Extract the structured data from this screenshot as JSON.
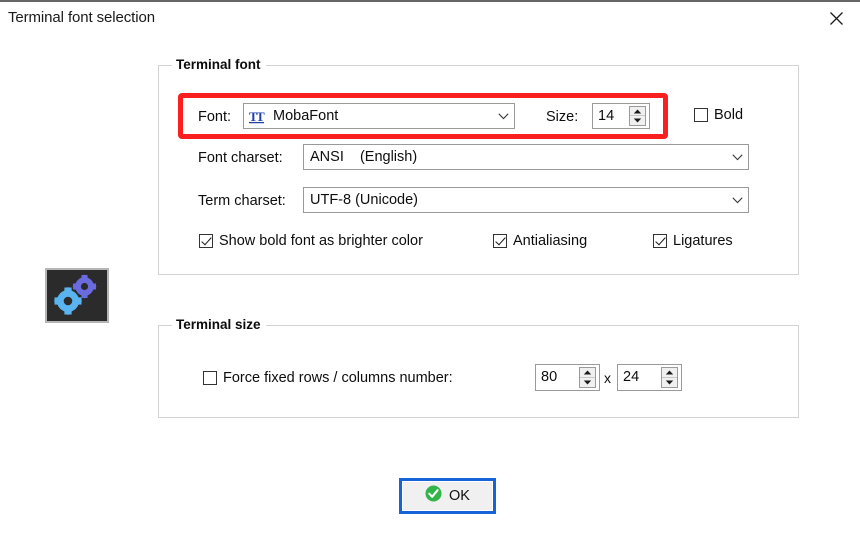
{
  "window": {
    "title": "Terminal font selection",
    "close_icon": "close-icon"
  },
  "sidebar": {
    "preview_icon": "gears-icon"
  },
  "groups": {
    "terminal_font": {
      "legend": "Terminal font",
      "font_label": "Font:",
      "font_value": "MobaFont",
      "font_icon": "truetype-font-icon",
      "size_label": "Size:",
      "size_value": "14",
      "bold_label": "Bold",
      "bold_checked": false,
      "font_charset_label": "Font charset:",
      "font_charset_value": "ANSI    (English)",
      "term_charset_label": "Term charset:",
      "term_charset_value": "UTF-8 (Unicode)",
      "show_bold_label": "Show bold font as brighter color",
      "show_bold_checked": true,
      "antialiasing_label": "Antialiasing",
      "antialiasing_checked": true,
      "ligatures_label": "Ligatures",
      "ligatures_checked": true
    },
    "terminal_size": {
      "legend": "Terminal size",
      "force_fixed_label": "Force fixed rows / columns number:",
      "force_fixed_checked": false,
      "columns_value": "80",
      "separator": "x",
      "rows_value": "24"
    }
  },
  "footer": {
    "ok_label": "OK",
    "ok_icon": "green-check-circle-icon"
  },
  "annotation": {
    "highlight_color": "#fa2020",
    "target": "font-and-size-row"
  },
  "colors": {
    "accent_blue": "#1565d8",
    "highlight_red": "#fa2020",
    "ok_green": "#31b54a",
    "groupbox_border": "#d3d3d3",
    "text": "#0d0d0d"
  }
}
